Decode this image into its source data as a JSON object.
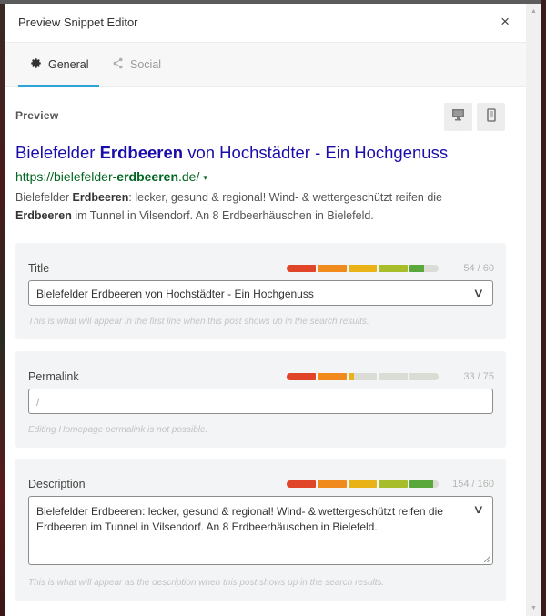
{
  "modal": {
    "title": "Preview Snippet Editor",
    "close_icon": "×"
  },
  "tabs": [
    {
      "label": "General",
      "icon": "gear-icon",
      "glyph": "✱",
      "active": true
    },
    {
      "label": "Social",
      "icon": "share-icon",
      "glyph": "<",
      "active": false
    }
  ],
  "preview": {
    "label": "Preview",
    "device_buttons": [
      "desktop-icon",
      "mobile-icon"
    ],
    "serp": {
      "title_parts": [
        {
          "text": "Bielefelder ",
          "bold": false
        },
        {
          "text": "Erdbeeren",
          "bold": true
        },
        {
          "text": " von Hochstädter - Ein Hochgenuss",
          "bold": false
        }
      ],
      "url_parts": [
        {
          "text": "https://bielefelder-",
          "bold": false
        },
        {
          "text": "erdbeeren",
          "bold": true
        },
        {
          "text": ".de/",
          "bold": false
        }
      ],
      "url_caret": "▾",
      "description_parts": [
        {
          "text": "Bielefelder ",
          "bold": false
        },
        {
          "text": "Erdbeeren",
          "bold": true
        },
        {
          "text": ": lecker, gesund & regional! Wind- & wettergeschützt reifen die ",
          "bold": false
        },
        {
          "text": "Erdbeeren",
          "bold": true
        },
        {
          "text": " im Tunnel in Vilsendorf. An 8 Erdbeerhäuschen in Bielefeld.",
          "bold": false
        }
      ]
    }
  },
  "fields": {
    "title": {
      "label": "Title",
      "value": "Bielefelder Erdbeeren von Hochstädter - Ein Hochgenuss",
      "count": "54 / 60",
      "current": 54,
      "max": 60,
      "help": "This is what will appear in the first line when this post shows up in the search results."
    },
    "permalink": {
      "label": "Permalink",
      "value": "/",
      "count": "33 / 75",
      "current": 33,
      "max": 75,
      "help": "Editing Homepage permalink is not possible."
    },
    "description": {
      "label": "Description",
      "value": "Bielefelder Erdbeeren: lecker, gesund & regional! Wind- & wettergeschützt reifen die Erdbeeren im Tunnel in Vilsendorf. An 8 Erdbeerhäuschen in Bielefeld.",
      "count": "154 / 160",
      "current": 154,
      "max": 160,
      "help": "This is what will appear as the description when this post shows up in the search results."
    }
  },
  "colors": {
    "accent": "#2ea3d8",
    "serp_link": "#1a0dab",
    "serp_url": "#006621",
    "meter_segments": [
      "#e0452a",
      "#f08a1c",
      "#e9b318",
      "#a8bd2a",
      "#5aa83c"
    ],
    "meter_empty": "#dcdcd6"
  }
}
